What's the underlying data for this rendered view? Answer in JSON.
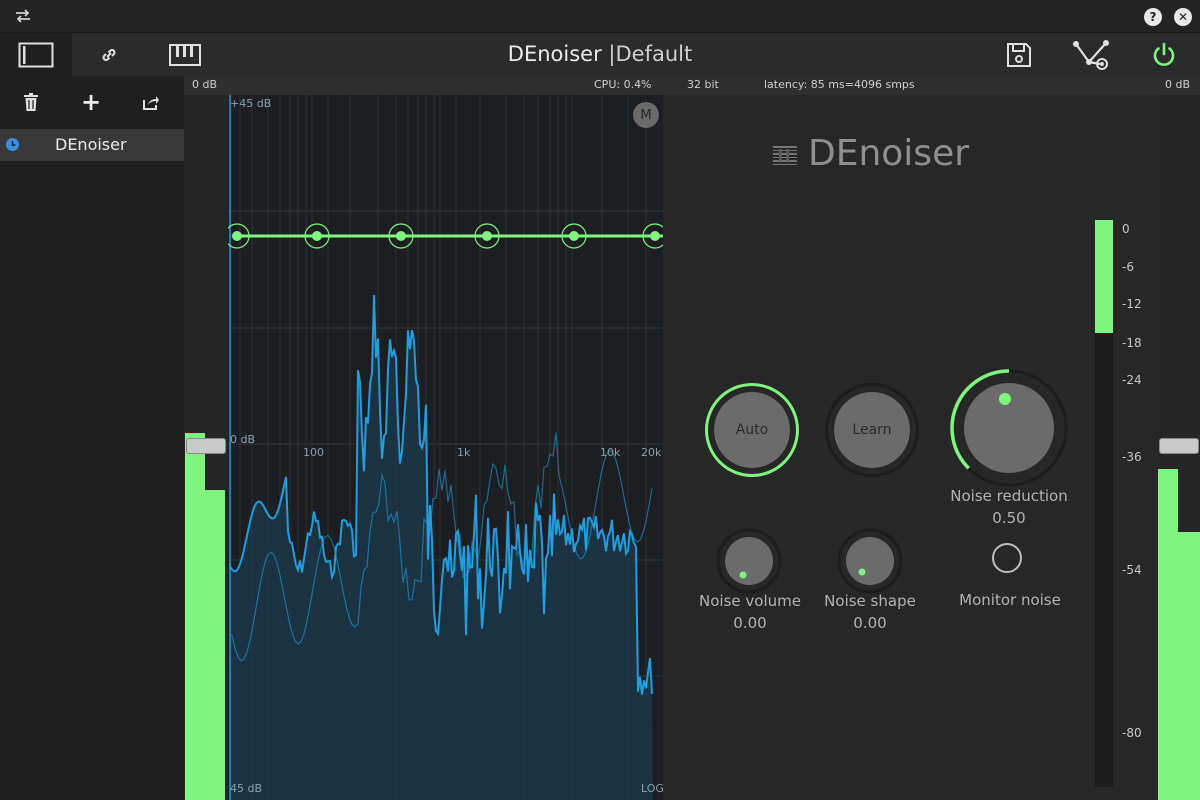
{
  "window": {
    "title": "DEnoiser",
    "separator": "|",
    "preset_name": "Default"
  },
  "topbar": {
    "swap_icon": "swap-arrows-icon",
    "help_icon": "help-icon",
    "close_icon": "close-icon"
  },
  "toolbar": {
    "tabs": [
      {
        "name": "plugin-view",
        "icon": "panel-icon"
      },
      {
        "name": "routing",
        "icon": "link-icon"
      },
      {
        "name": "keyboard",
        "icon": "piano-keys-icon"
      }
    ],
    "save_icon": "save-icon",
    "graph_icon": "node-graph-icon",
    "power_icon": "power-icon"
  },
  "status": {
    "in_level": "0 dB",
    "cpu": "CPU: 0.4%",
    "bit_depth": "32 bit",
    "latency": "latency: 85 ms=4096 smps",
    "out_level": "0 dB"
  },
  "sidebar": {
    "actions": [
      "delete",
      "add",
      "export"
    ],
    "presets": [
      {
        "label": "DEnoiser"
      }
    ]
  },
  "spectrum": {
    "top_label": "+45 dB",
    "mid_label": "0 dB",
    "bottom_label": "45 dB",
    "corner_label": "LOG",
    "m_button": "M",
    "freq_labels": [
      "100",
      "1k",
      "10k",
      "20k"
    ]
  },
  "plugin": {
    "brand": "DEnoiser",
    "auto_label": "Auto",
    "learn_label": "Learn",
    "noise_reduction_label": "Noise reduction",
    "noise_reduction_value": "0.50",
    "noise_volume_label": "Noise volume",
    "noise_volume_value": "0.00",
    "noise_shape_label": "Noise shape",
    "noise_shape_value": "0.00",
    "monitor_noise_label": "Monitor noise",
    "scale_labels": [
      "0",
      "-6",
      "-12",
      "-18",
      "-24",
      "-36",
      "-54",
      "-80"
    ]
  },
  "meters": {
    "input_left_level": 0.52,
    "input_right_level": 0.44,
    "output_left_level": 0.47,
    "output_right_level": 0.38,
    "reduction_level": 0.2
  },
  "colors": {
    "accent": "#7ff57f",
    "spectrum": "#1e9fe0",
    "background": "#262626"
  }
}
